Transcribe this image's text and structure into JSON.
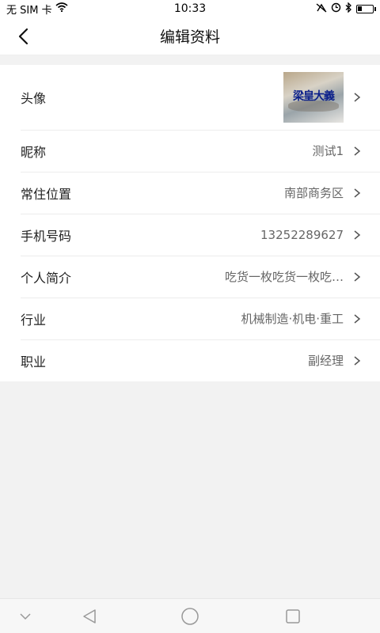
{
  "status_bar": {
    "carrier": "无 SIM 卡",
    "time": "10:33",
    "battery_level": 0.3
  },
  "header": {
    "title": "编辑资料"
  },
  "profile": {
    "avatar": {
      "label": "头像",
      "image_text": "梁皇大義"
    },
    "rows": [
      {
        "label": "昵称",
        "value": "测试1"
      },
      {
        "label": "常住位置",
        "value": "南部商务区"
      },
      {
        "label": "手机号码",
        "value": "13252289627"
      },
      {
        "label": "个人简介",
        "value": "吃货一枚吃货一枚吃…"
      },
      {
        "label": "行业",
        "value": "机械制造·机电·重工"
      },
      {
        "label": "职业",
        "value": "副经理"
      }
    ]
  },
  "icons": {
    "back": "back-arrow-icon",
    "chevron": "chevron-right-icon",
    "nav": [
      "collapse-down-icon",
      "back-triangle-icon",
      "home-circle-icon",
      "recents-square-icon"
    ]
  },
  "colors": {
    "background": "#f2f2f2",
    "card": "#ffffff",
    "label_text": "#222222",
    "value_text": "#666666",
    "avatar_text": "#0a1f8a"
  }
}
